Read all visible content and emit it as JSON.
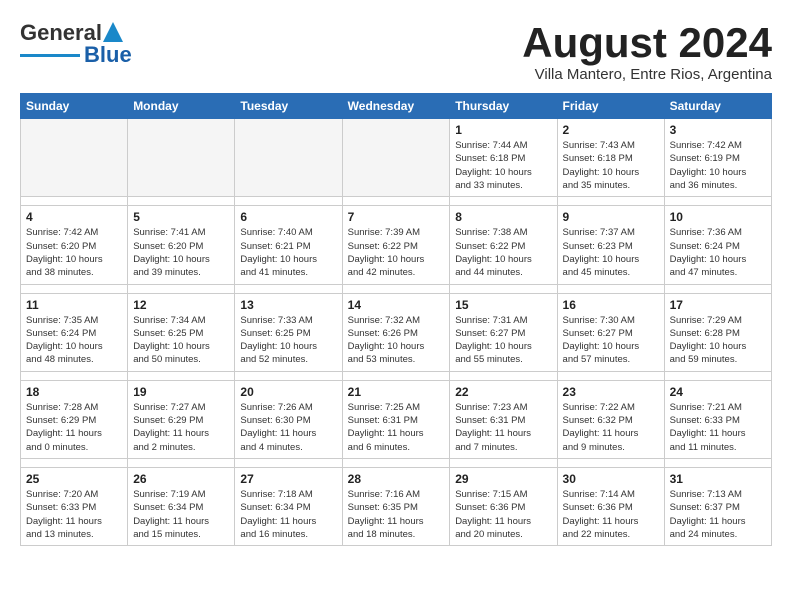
{
  "logo": {
    "general": "General",
    "blue": "Blue"
  },
  "title": "August 2024",
  "subtitle": "Villa Mantero, Entre Rios, Argentina",
  "days_of_week": [
    "Sunday",
    "Monday",
    "Tuesday",
    "Wednesday",
    "Thursday",
    "Friday",
    "Saturday"
  ],
  "weeks": [
    [
      {
        "day": "",
        "info": ""
      },
      {
        "day": "",
        "info": ""
      },
      {
        "day": "",
        "info": ""
      },
      {
        "day": "",
        "info": ""
      },
      {
        "day": "1",
        "info": "Sunrise: 7:44 AM\nSunset: 6:18 PM\nDaylight: 10 hours\nand 33 minutes."
      },
      {
        "day": "2",
        "info": "Sunrise: 7:43 AM\nSunset: 6:18 PM\nDaylight: 10 hours\nand 35 minutes."
      },
      {
        "day": "3",
        "info": "Sunrise: 7:42 AM\nSunset: 6:19 PM\nDaylight: 10 hours\nand 36 minutes."
      }
    ],
    [
      {
        "day": "4",
        "info": "Sunrise: 7:42 AM\nSunset: 6:20 PM\nDaylight: 10 hours\nand 38 minutes."
      },
      {
        "day": "5",
        "info": "Sunrise: 7:41 AM\nSunset: 6:20 PM\nDaylight: 10 hours\nand 39 minutes."
      },
      {
        "day": "6",
        "info": "Sunrise: 7:40 AM\nSunset: 6:21 PM\nDaylight: 10 hours\nand 41 minutes."
      },
      {
        "day": "7",
        "info": "Sunrise: 7:39 AM\nSunset: 6:22 PM\nDaylight: 10 hours\nand 42 minutes."
      },
      {
        "day": "8",
        "info": "Sunrise: 7:38 AM\nSunset: 6:22 PM\nDaylight: 10 hours\nand 44 minutes."
      },
      {
        "day": "9",
        "info": "Sunrise: 7:37 AM\nSunset: 6:23 PM\nDaylight: 10 hours\nand 45 minutes."
      },
      {
        "day": "10",
        "info": "Sunrise: 7:36 AM\nSunset: 6:24 PM\nDaylight: 10 hours\nand 47 minutes."
      }
    ],
    [
      {
        "day": "11",
        "info": "Sunrise: 7:35 AM\nSunset: 6:24 PM\nDaylight: 10 hours\nand 48 minutes."
      },
      {
        "day": "12",
        "info": "Sunrise: 7:34 AM\nSunset: 6:25 PM\nDaylight: 10 hours\nand 50 minutes."
      },
      {
        "day": "13",
        "info": "Sunrise: 7:33 AM\nSunset: 6:25 PM\nDaylight: 10 hours\nand 52 minutes."
      },
      {
        "day": "14",
        "info": "Sunrise: 7:32 AM\nSunset: 6:26 PM\nDaylight: 10 hours\nand 53 minutes."
      },
      {
        "day": "15",
        "info": "Sunrise: 7:31 AM\nSunset: 6:27 PM\nDaylight: 10 hours\nand 55 minutes."
      },
      {
        "day": "16",
        "info": "Sunrise: 7:30 AM\nSunset: 6:27 PM\nDaylight: 10 hours\nand 57 minutes."
      },
      {
        "day": "17",
        "info": "Sunrise: 7:29 AM\nSunset: 6:28 PM\nDaylight: 10 hours\nand 59 minutes."
      }
    ],
    [
      {
        "day": "18",
        "info": "Sunrise: 7:28 AM\nSunset: 6:29 PM\nDaylight: 11 hours\nand 0 minutes."
      },
      {
        "day": "19",
        "info": "Sunrise: 7:27 AM\nSunset: 6:29 PM\nDaylight: 11 hours\nand 2 minutes."
      },
      {
        "day": "20",
        "info": "Sunrise: 7:26 AM\nSunset: 6:30 PM\nDaylight: 11 hours\nand 4 minutes."
      },
      {
        "day": "21",
        "info": "Sunrise: 7:25 AM\nSunset: 6:31 PM\nDaylight: 11 hours\nand 6 minutes."
      },
      {
        "day": "22",
        "info": "Sunrise: 7:23 AM\nSunset: 6:31 PM\nDaylight: 11 hours\nand 7 minutes."
      },
      {
        "day": "23",
        "info": "Sunrise: 7:22 AM\nSunset: 6:32 PM\nDaylight: 11 hours\nand 9 minutes."
      },
      {
        "day": "24",
        "info": "Sunrise: 7:21 AM\nSunset: 6:33 PM\nDaylight: 11 hours\nand 11 minutes."
      }
    ],
    [
      {
        "day": "25",
        "info": "Sunrise: 7:20 AM\nSunset: 6:33 PM\nDaylight: 11 hours\nand 13 minutes."
      },
      {
        "day": "26",
        "info": "Sunrise: 7:19 AM\nSunset: 6:34 PM\nDaylight: 11 hours\nand 15 minutes."
      },
      {
        "day": "27",
        "info": "Sunrise: 7:18 AM\nSunset: 6:34 PM\nDaylight: 11 hours\nand 16 minutes."
      },
      {
        "day": "28",
        "info": "Sunrise: 7:16 AM\nSunset: 6:35 PM\nDaylight: 11 hours\nand 18 minutes."
      },
      {
        "day": "29",
        "info": "Sunrise: 7:15 AM\nSunset: 6:36 PM\nDaylight: 11 hours\nand 20 minutes."
      },
      {
        "day": "30",
        "info": "Sunrise: 7:14 AM\nSunset: 6:36 PM\nDaylight: 11 hours\nand 22 minutes."
      },
      {
        "day": "31",
        "info": "Sunrise: 7:13 AM\nSunset: 6:37 PM\nDaylight: 11 hours\nand 24 minutes."
      }
    ]
  ]
}
